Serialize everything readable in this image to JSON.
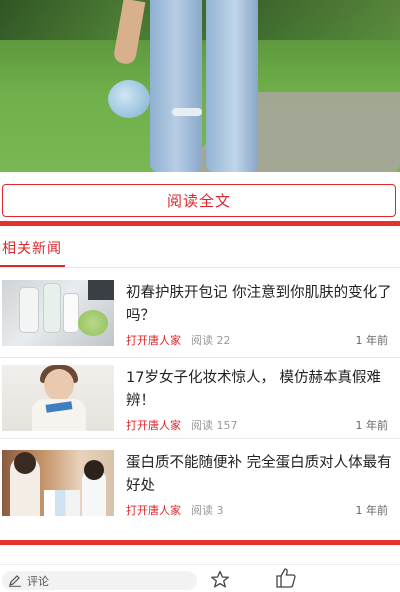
{
  "article": {
    "read_full_label": "阅读全文"
  },
  "related": {
    "title": "相关新闻",
    "items": [
      {
        "title": "初春护肤开包记 你注意到你肌肤的变化了吗？",
        "source": "打开唐人家",
        "reads": "阅读 22",
        "time": "1 年前"
      },
      {
        "title": "17岁女子化妆术惊人，  模仿赫本真假难辨！",
        "source": "打开唐人家",
        "reads": "阅读 157",
        "time": "1 年前"
      },
      {
        "title": "蛋白质不能随便补 完全蛋白质对人体最有好处",
        "source": "打开唐人家",
        "reads": "阅读 3",
        "time": "1 年前"
      }
    ]
  },
  "bottom_bar": {
    "comment_label": "评论",
    "icons": [
      "pencil-icon",
      "star-icon",
      "thumbs-up-icon"
    ]
  },
  "colors": {
    "accent": "#e0262c",
    "divider_bar": "#e5322e"
  }
}
